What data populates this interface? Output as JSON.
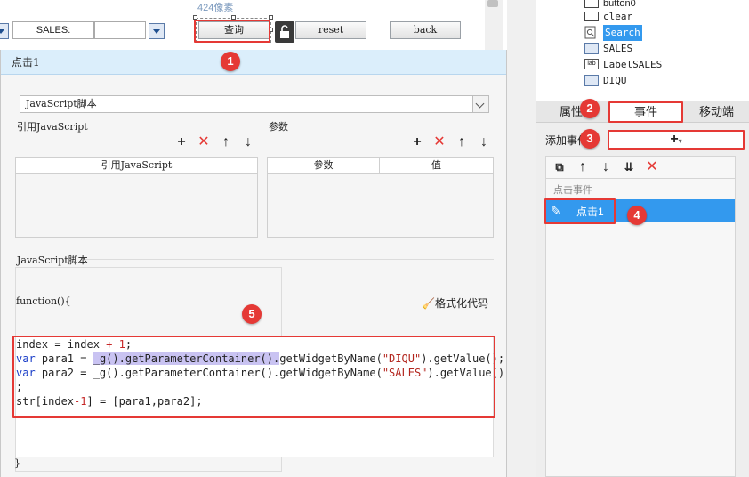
{
  "canvas": {
    "size_label": "424像素",
    "sales_label": "SALES:",
    "query_button": "查询",
    "reset_button": "reset",
    "back_button": "back"
  },
  "dialog": {
    "title": "点击1",
    "script_type": "JavaScript脚本",
    "ref_js_label": "引用JavaScript",
    "params_label": "参数",
    "ref_js_col": "引用JavaScript",
    "params_cols": [
      "参数",
      "值"
    ],
    "script_section": "JavaScript脚本",
    "func_open": "function(){",
    "format_code": "格式化代码",
    "func_close": "}",
    "code": {
      "l1_a": "index = index ",
      "l1_op": "+",
      "l1_b": " ",
      "l1_num": "1",
      "l1_c": ";",
      "l2_kw": "var",
      "l2_a": " para1 = ",
      "l2_hl1": "_g().getParameterContainer().",
      "l2_b": "getWidgetByName(",
      "l2_str": "\"DIQU\"",
      "l2_c": ").getValue();",
      "l3_kw": "var",
      "l3_a": " para2 = _g().getParameterContainer().getWidgetByName(",
      "l3_str": "\"SALES\"",
      "l3_c": ").getValue()",
      "l4": ";",
      "l5_a": "str[index",
      "l5_op": "-",
      "l5_num": "1",
      "l5_b": "] = [para1,para2];"
    }
  },
  "tree": {
    "items": [
      {
        "label": "button0",
        "icon": "button-icon"
      },
      {
        "label": "clear",
        "icon": "button-icon"
      },
      {
        "label": "Search",
        "icon": "search-widget-icon"
      },
      {
        "label": "SALES",
        "icon": "combo-icon"
      },
      {
        "label": "LabelSALES",
        "icon": "label-icon"
      },
      {
        "label": "DIQU",
        "icon": "combo-icon"
      }
    ]
  },
  "right": {
    "tabs": [
      "属性",
      "事件",
      "移动端"
    ],
    "add_event_label": "添加事件",
    "add_event_button": "+",
    "event_header": "点击事件",
    "event_item": "点击1"
  },
  "badges": [
    "1",
    "2",
    "3",
    "4",
    "5"
  ],
  "colors": {
    "accent": "#3399ee",
    "annotation": "#e53935",
    "dialog_title_bg": "#dbeefb"
  }
}
